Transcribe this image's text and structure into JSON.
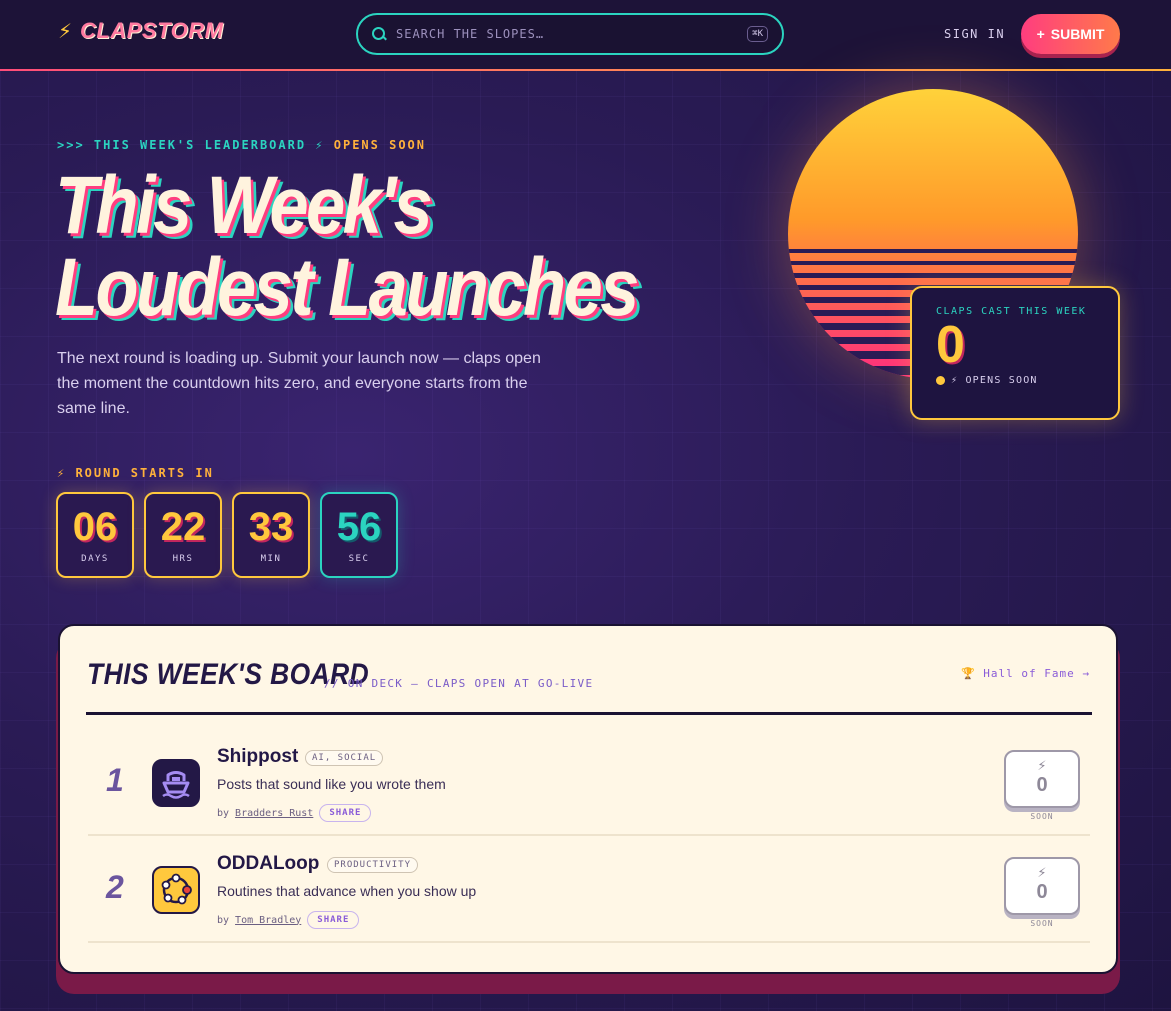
{
  "brand": {
    "name": "CLAPSTORM"
  },
  "search": {
    "placeholder": "SEARCH THE SLOPES…",
    "shortcut": "⌘K"
  },
  "nav": {
    "sign_in": "SIGN IN",
    "submit": "SUBMIT"
  },
  "hero": {
    "eyebrow_prefix": ">>> THIS WEEK'S LEADERBOARD ⚡",
    "eyebrow_status": "OPENS SOON",
    "title_line1": "This Week's",
    "title_line2": "Loudest Launches",
    "description": "The next round is loading up. Submit your launch now — claps open the moment the countdown hits zero, and everyone starts from the same line."
  },
  "countdown": {
    "label": "⚡ ROUND STARTS IN",
    "units": [
      {
        "value": "06",
        "unit": "DAYS"
      },
      {
        "value": "22",
        "unit": "HRS"
      },
      {
        "value": "33",
        "unit": "MIN"
      },
      {
        "value": "56",
        "unit": "SEC"
      }
    ]
  },
  "claps_card": {
    "label": "CLAPS CAST THIS WEEK",
    "value": "0",
    "status": "⚡ OPENS SOON"
  },
  "board": {
    "title": "THIS WEEK'S BOARD",
    "subtitle": "// ON DECK — CLAPS OPEN AT GO-LIVE",
    "hall_of_fame": "🏆 Hall of Fame →",
    "rows": [
      {
        "rank": "1",
        "name": "Shippost",
        "tag": "AI, SOCIAL",
        "tagline": "Posts that sound like you wrote them",
        "by": "by",
        "maker": "Bradders Rust",
        "share": "SHARE",
        "claps": "0",
        "clap_status": "SOON"
      },
      {
        "rank": "2",
        "name": "ODDALoop",
        "tag": "PRODUCTIVITY",
        "tagline": "Routines that advance when you show up",
        "by": "by",
        "maker": "Tom Bradley",
        "share": "SHARE",
        "claps": "0",
        "clap_status": "SOON"
      }
    ]
  },
  "colors": {
    "accent_pink": "#ff3d7f",
    "accent_teal": "#2bd4c0",
    "accent_yellow": "#ffc83d",
    "background": "#231846",
    "board": "#fff7e6"
  }
}
